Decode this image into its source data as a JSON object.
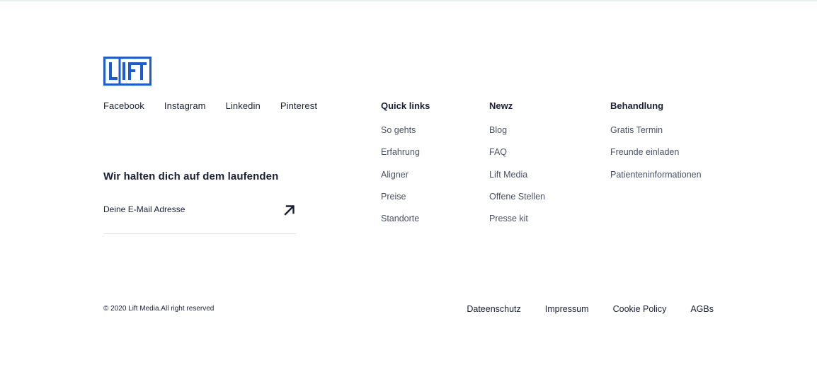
{
  "logo": {
    "text": "LIFT",
    "color": "#1b5bd8"
  },
  "social": [
    {
      "label": "Facebook"
    },
    {
      "label": "Instagram"
    },
    {
      "label": "Linkedin"
    },
    {
      "label": "Pinterest"
    }
  ],
  "newsletter": {
    "title": "Wir halten dich auf dem laufenden",
    "placeholder": "Deine E-Mail Adresse",
    "submit_icon": "arrow-up-right-icon"
  },
  "columns": {
    "quick_links": {
      "heading": "Quick links",
      "items": [
        "So gehts",
        "Erfahrung",
        "Aligner",
        "Preise",
        "Standorte"
      ]
    },
    "newz": {
      "heading": "Newz",
      "items": [
        "Blog",
        "FAQ",
        "Lift Media",
        "Offene Stellen",
        "Presse kit"
      ]
    },
    "behandlung": {
      "heading": "Behandlung",
      "items": [
        "Gratis Termin",
        "Freunde einladen",
        "Patienteninformationen"
      ]
    }
  },
  "copyright": "© 2020 Lift Media.All right reserved",
  "legal": [
    "Dateenschutz",
    "Impressum",
    "Cookie Policy",
    "AGBs"
  ]
}
